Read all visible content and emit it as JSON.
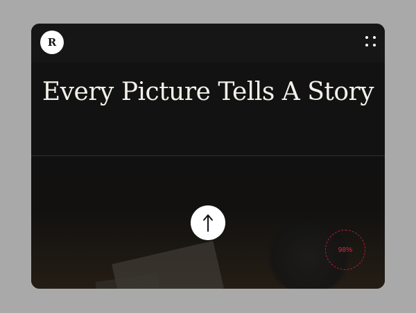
{
  "header": {
    "logo_letter": "R",
    "logo_icon": "logo-r-icon",
    "menu_icon": "grid-dots-icon"
  },
  "hero": {
    "title": "Every Picture Tells A Story"
  },
  "scroll_top": {
    "icon": "arrow-up-icon"
  },
  "progress": {
    "label": "98%",
    "value": 98,
    "color": "#d92a4d"
  },
  "colors": {
    "background": "#a9a9a9",
    "card": "#121212",
    "accent": "#d92a4d"
  }
}
